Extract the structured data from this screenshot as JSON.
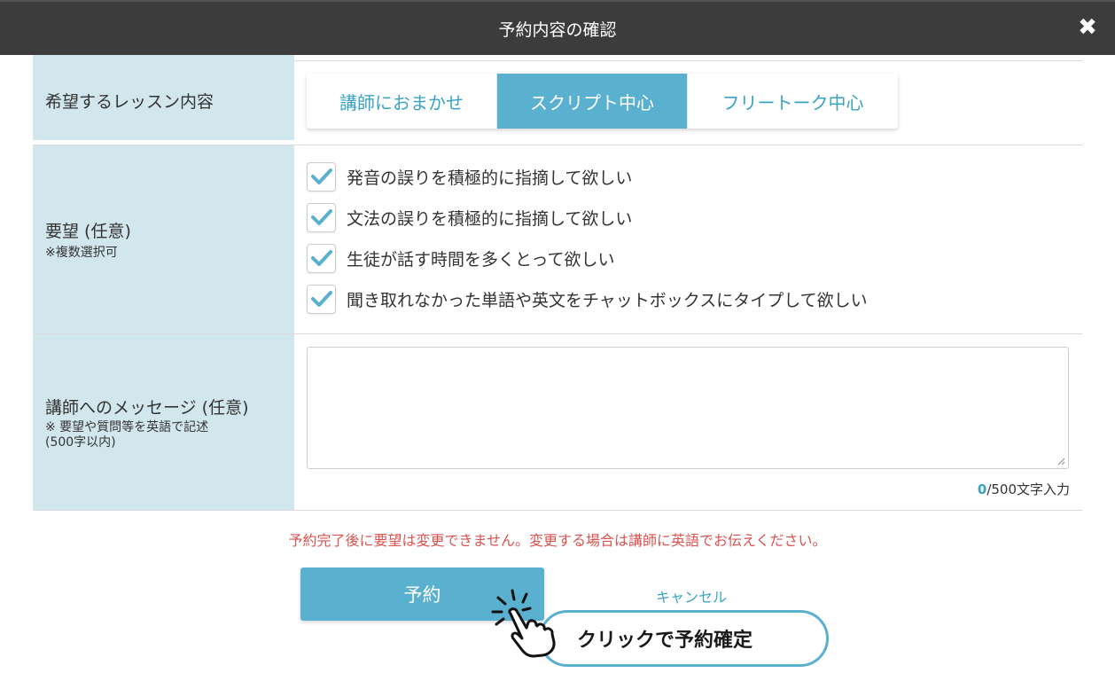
{
  "header": {
    "title": "予約内容の確認",
    "close_icon": "close-icon"
  },
  "lesson_content": {
    "label": "希望するレッスン内容",
    "options": [
      {
        "label": "講師におまかせ",
        "selected": false
      },
      {
        "label": "スクリプト中心",
        "selected": true
      },
      {
        "label": "フリートーク中心",
        "selected": false
      }
    ]
  },
  "requests": {
    "label": "要望 (任意)",
    "sublabel": "※複数選択可",
    "items": [
      {
        "label": "発音の誤りを積極的に指摘して欲しい",
        "checked": true
      },
      {
        "label": "文法の誤りを積極的に指摘して欲しい",
        "checked": true
      },
      {
        "label": "生徒が話す時間を多くとって欲しい",
        "checked": true
      },
      {
        "label": "聞き取れなかった単語や英文をチャットボックスにタイプして欲しい",
        "checked": true
      }
    ]
  },
  "message": {
    "label": "講師へのメッセージ (任意)",
    "sublabel_1": "※ 要望や質問等を英語で記述",
    "sublabel_2": "(500字以内)",
    "value": "",
    "count": "0",
    "limit": "/500文字入力"
  },
  "warning": "予約完了後に要望は変更できません。変更する場合は講師に英語でお伝えください。",
  "actions": {
    "reserve_label": "予約",
    "cancel_label": "キャンセル"
  },
  "callout": {
    "text": "クリックで予約確定"
  },
  "colors": {
    "accent": "#5ab0cf",
    "header_bg": "#3c3c3c",
    "label_bg": "#d2e6ee",
    "warning": "#d9534f"
  }
}
